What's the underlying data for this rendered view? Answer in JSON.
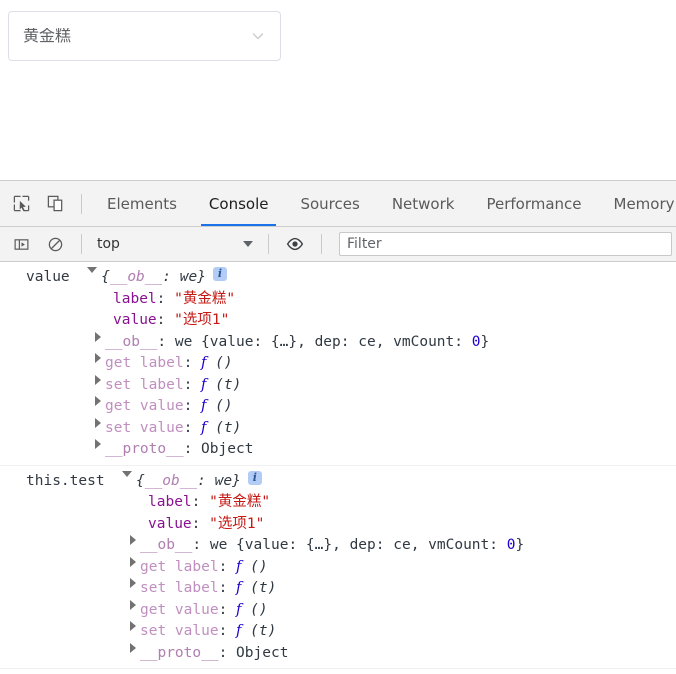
{
  "page": {
    "select": {
      "name": "select-dropdown",
      "value": "黄金糕",
      "chevron_icon": "chevron-down-icon"
    }
  },
  "devtools": {
    "toolbar_icons": [
      {
        "name": "inspect-element-icon",
        "title": "Inspect element"
      },
      {
        "name": "device-toolbar-icon",
        "title": "Toggle device toolbar"
      }
    ],
    "tabs": [
      {
        "label": "Elements",
        "active": false
      },
      {
        "label": "Console",
        "active": true
      },
      {
        "label": "Sources",
        "active": false
      },
      {
        "label": "Network",
        "active": false
      },
      {
        "label": "Performance",
        "active": false
      },
      {
        "label": "Memory",
        "active": false
      }
    ],
    "console_toolbar": {
      "sidebar_icon": "console-sidebar-icon",
      "clear_icon": "clear-console-icon",
      "context": "top",
      "context_caret_icon": "caret-down-icon",
      "eye_icon": "live-expression-eye-icon",
      "filter_placeholder": "Filter",
      "filter_value": ""
    },
    "accent_color": "#1a73e8",
    "toolbar_bg": "#f3f3f3",
    "border_color": "#cdcdcd"
  },
  "console": {
    "messages": [
      {
        "expression": "value",
        "triangle": "expanded",
        "preview_open": "{",
        "preview_key": "__ob__",
        "preview_sep": ": ",
        "preview_val": "we",
        "preview_close": "}",
        "badge": "i",
        "props": [
          {
            "kind": "string",
            "key": "label",
            "value": "\"黄金糕\"",
            "indent": 2
          },
          {
            "kind": "string",
            "key": "value",
            "value": "\"选项1\"",
            "indent": 2
          },
          {
            "kind": "object",
            "key": "__ob__",
            "cls": "we",
            "open": " {",
            "inner_a": "value: ",
            "inner_a_val": "{…}",
            "inner_b": ", dep: ",
            "inner_b_val": "ce",
            "inner_c": ", vmCount: ",
            "inner_c_num": "0",
            "close": "}",
            "indent": 1
          },
          {
            "kind": "accessor",
            "key": "get label",
            "fn": "f",
            "args": "()",
            "indent": 1
          },
          {
            "kind": "accessor",
            "key": "set label",
            "fn": "f",
            "args": "(t)",
            "indent": 1
          },
          {
            "kind": "accessor",
            "key": "get value",
            "fn": "f",
            "args": "()",
            "indent": 1
          },
          {
            "kind": "accessor",
            "key": "set value",
            "fn": "f",
            "args": "(t)",
            "indent": 1
          },
          {
            "kind": "proto",
            "key": "__proto__",
            "value": "Object",
            "indent": 1
          }
        ]
      },
      {
        "expression": "this.test",
        "triangle": "expanded",
        "preview_open": "{",
        "preview_key": "__ob__",
        "preview_sep": ": ",
        "preview_val": "we",
        "preview_close": "}",
        "badge": "i",
        "props": [
          {
            "kind": "string",
            "key": "label",
            "value": "\"黄金糕\"",
            "indent": 2
          },
          {
            "kind": "string",
            "key": "value",
            "value": "\"选项1\"",
            "indent": 2
          },
          {
            "kind": "object",
            "key": "__ob__",
            "cls": "we",
            "open": " {",
            "inner_a": "value: ",
            "inner_a_val": "{…}",
            "inner_b": ", dep: ",
            "inner_b_val": "ce",
            "inner_c": ", vmCount: ",
            "inner_c_num": "0",
            "close": "}",
            "indent": 1
          },
          {
            "kind": "accessor",
            "key": "get label",
            "fn": "f",
            "args": "()",
            "indent": 1
          },
          {
            "kind": "accessor",
            "key": "set label",
            "fn": "f",
            "args": "(t)",
            "indent": 1
          },
          {
            "kind": "accessor",
            "key": "get value",
            "fn": "f",
            "args": "()",
            "indent": 1
          },
          {
            "kind": "accessor",
            "key": "set value",
            "fn": "f",
            "args": "(t)",
            "indent": 1
          },
          {
            "kind": "proto",
            "key": "__proto__",
            "value": "Object",
            "indent": 1
          }
        ]
      }
    ],
    "colors": {
      "string": "#c41a16",
      "key": "#881391",
      "number": "#1c00cf",
      "text": "#303942"
    }
  }
}
